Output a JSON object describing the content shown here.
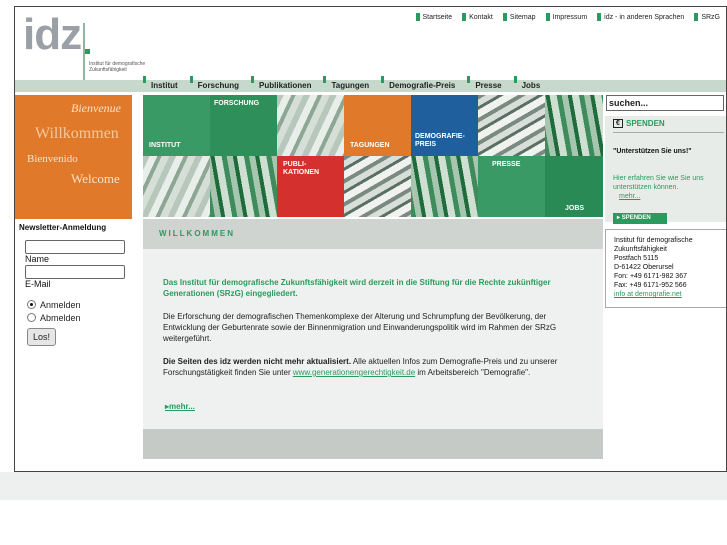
{
  "logo": {
    "text": "idz",
    "subtitle": "Institut für demografische Zukunftsfähigkeit"
  },
  "top_links": [
    "Startseite",
    "Kontakt",
    "Sitemap",
    "Impressum",
    "idz - in anderen Sprachen",
    "SRzG"
  ],
  "nav": [
    "Institut",
    "Forschung",
    "Publikationen",
    "Tagungen",
    "Demografie-Preis",
    "Presse",
    "Jobs"
  ],
  "welcome_words": [
    "Bienvenue",
    "Willkommen",
    "Bienvenido",
    "Welcome"
  ],
  "tiles": {
    "institut": "INSTITUT",
    "forschung": "FORSCHUNG",
    "tagungen": "TAGUNGEN",
    "demografie": "DEMOGRAFIE-PREIS",
    "publikationen": "PUBLI-KATIONEN",
    "presse": "PRESSE",
    "jobs": "JOBS"
  },
  "newsletter": {
    "title": "Newsletter-Anmeldung",
    "name_label": "Name",
    "email_label": "E-Mail",
    "radio_subscribe": "Anmelden",
    "radio_unsubscribe": "Abmelden",
    "submit": "Los!"
  },
  "main": {
    "heading": "WILLKOMMEN",
    "intro": "Das Institut für demografische Zukunftsfähigkeit wird derzeit in die Stiftung für die Rechte zukünftiger Generationen (SRzG) eingegliedert.",
    "para1": "Die Erforschung der demografischen Themenkomplexe der Alterung und  Schrumpfung der Bevölkerung, der Entwicklung der Geburtenrate sowie der Binnenmigration und Einwanderungspolitik wird im Rahmen der SRzG weitergeführt.",
    "para2_bold": "Die Seiten des idz werden nicht mehr aktualisiert.",
    "para2_rest": " Alle aktuellen Infos zum Demografie-Preis und zu unserer Forschungstätigkeit finden Sie unter ",
    "para2_link": "www.generationengerechtigkeit.de",
    "para2_end": " im Arbeitsbereich \"Demografie\".",
    "more": "mehr..."
  },
  "right": {
    "search_placeholder": "suchen...",
    "spenden_title": "SPENDEN",
    "spenden_quote": "\"Unterstützen Sie uns!\"",
    "spenden_text": "Hier erfahren Sie wie Sie uns unterstützen können.",
    "spenden_more": "mehr...",
    "spenden_button": "SPENDEN"
  },
  "address": {
    "lines": [
      "Institut für demografische Zukunftsfähigkeit",
      "Postfach 5115",
      "D-61422 Oberursel",
      "Fon: +49 6171-982 367",
      "Fax: +49 6171-952 566"
    ],
    "email": "info at demografie.net"
  },
  "colors": {
    "green": "#2a9a5e",
    "orange": "#e07a2a",
    "blue": "#1f5f9e",
    "red": "#d4312e"
  }
}
